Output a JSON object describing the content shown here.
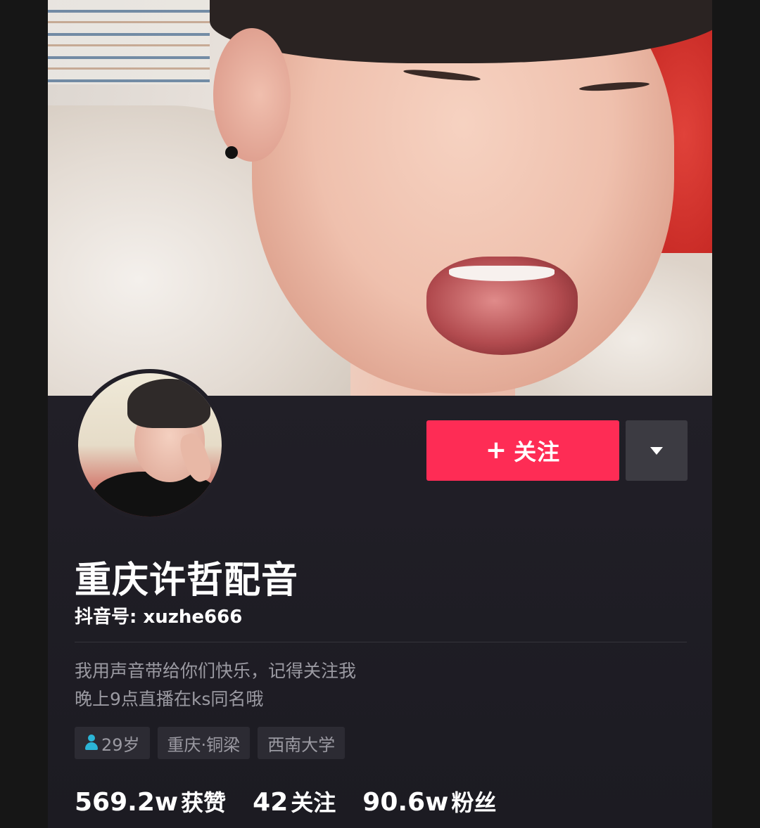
{
  "profile": {
    "name": "重庆许哲配音",
    "uid_label": "抖音号: xuzhe666",
    "follow_label": "关注",
    "follow_icon": "+",
    "more_icon": "chevron-down-icon",
    "bio_lines": [
      "我用声音带给你们快乐，记得关注我",
      "晚上9点直播在ks同名哦"
    ],
    "tags": {
      "age": "29岁",
      "location": "重庆·铜梁",
      "school": "西南大学"
    },
    "stats": [
      {
        "value": "569.2w",
        "label": "获赞"
      },
      {
        "value": "42",
        "label": "关注"
      },
      {
        "value": "90.6w",
        "label": "粉丝"
      }
    ]
  },
  "colors": {
    "accent": "#fe2c55",
    "background": "#1c1b22",
    "secondary_text": "#9b9aa2",
    "gender_icon": "#2bb5d6"
  }
}
